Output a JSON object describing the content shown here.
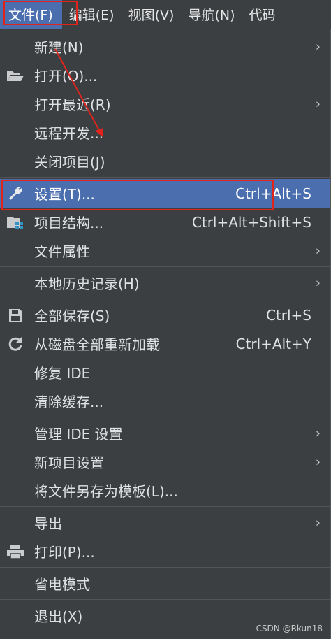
{
  "menubar": {
    "items": [
      {
        "label": "文件(F)"
      },
      {
        "label": "编辑(E)"
      },
      {
        "label": "视图(V)"
      },
      {
        "label": "导航(N)"
      },
      {
        "label": "代码"
      }
    ]
  },
  "menu": {
    "items": [
      {
        "label": "新建(N)",
        "submenu": "›"
      },
      {
        "label": "打开(O)...",
        "icon": "folder-icon"
      },
      {
        "label": "打开最近(R)",
        "submenu": "›"
      },
      {
        "label": "远程开发..."
      },
      {
        "label": "关闭项目(J)"
      },
      {
        "label": "设置(T)...",
        "shortcut": "Ctrl+Alt+S",
        "icon": "wrench-icon"
      },
      {
        "label": "项目结构...",
        "shortcut": "Ctrl+Alt+Shift+S",
        "icon": "project-structure-icon"
      },
      {
        "label": "文件属性",
        "submenu": "›"
      },
      {
        "label": "本地历史记录(H)",
        "submenu": "›"
      },
      {
        "label": "全部保存(S)",
        "shortcut": "Ctrl+S",
        "icon": "save-icon"
      },
      {
        "label": "从磁盘全部重新加载",
        "shortcut": "Ctrl+Alt+Y",
        "icon": "reload-icon"
      },
      {
        "label": "修复 IDE"
      },
      {
        "label": "清除缓存..."
      },
      {
        "label": "管理 IDE 设置",
        "submenu": "›"
      },
      {
        "label": "新项目设置",
        "submenu": "›"
      },
      {
        "label": "将文件另存为模板(L)..."
      },
      {
        "label": "导出",
        "submenu": "›"
      },
      {
        "label": "打印(P)...",
        "icon": "printer-icon"
      },
      {
        "label": "省电模式"
      },
      {
        "label": "退出(X)"
      }
    ]
  },
  "watermark": "CSDN @Rkun18",
  "colors": {
    "background": "#3c3f41",
    "selection": "#4b6eaf",
    "annotation_red": "#e0241b"
  }
}
